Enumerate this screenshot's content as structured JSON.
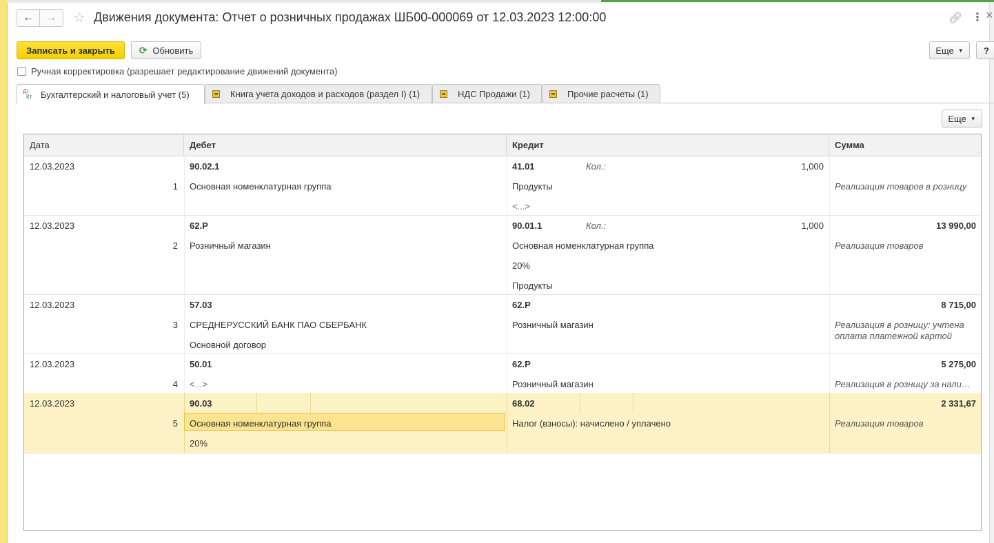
{
  "window": {
    "title": "Движения документа: Отчет о розничных продажах ШБ00-000069 от 12.03.2023 12:00:00"
  },
  "toolbar": {
    "save_close": "Записать и закрыть",
    "refresh": "Обновить",
    "more": "Еще",
    "help": "?"
  },
  "manual_correction": {
    "label": "Ручная корректировка (разрешает редактирование движений документа)",
    "checked": false
  },
  "tabs": [
    {
      "label": "Бухгалтерский и налоговый учет (5)",
      "active": true,
      "icon": "dt-kt-icon"
    },
    {
      "label": "Книга учета доходов и расходов (раздел I) (1)",
      "active": false,
      "icon": "register-icon"
    },
    {
      "label": "НДС Продажи (1)",
      "active": false,
      "icon": "register-icon"
    },
    {
      "label": "Прочие расчеты (1)",
      "active": false,
      "icon": "register-icon"
    }
  ],
  "icons": {
    "dt": "Дт",
    "kt": "Кт"
  },
  "table": {
    "more": "Еще",
    "columns": [
      "Дата",
      "Дебет",
      "Кредит",
      "Сумма"
    ],
    "rows": [
      {
        "date": "12.03.2023",
        "n": "1",
        "debit_account": "90.02.1",
        "debit_lines": [
          "Основная номенклатурная группа"
        ],
        "credit_account": "41.01",
        "qty_label": "Кол.:",
        "qty": "1,000",
        "credit_lines": [
          "Продукты",
          "<...>"
        ],
        "amount": "",
        "description": "Реализация товаров в розницу"
      },
      {
        "date": "12.03.2023",
        "n": "2",
        "debit_account": "62.Р",
        "debit_lines": [
          "Розничный магазин"
        ],
        "credit_account": "90.01.1",
        "qty_label": "Кол.:",
        "qty": "1,000",
        "credit_lines": [
          "Основная номенклатурная группа",
          "20%",
          "Продукты"
        ],
        "amount": "13 990,00",
        "description": "Реализация товаров"
      },
      {
        "date": "12.03.2023",
        "n": "3",
        "debit_account": "57.03",
        "debit_lines": [
          "СРЕДНЕРУССКИЙ БАНК ПАО СБЕРБАНК",
          "Основной договор"
        ],
        "credit_account": "62.Р",
        "credit_lines": [
          "Розничный магазин"
        ],
        "amount": "8 715,00",
        "description": "Реализация в розницу: учтена",
        "description2": "оплата платежной картой"
      },
      {
        "date": "12.03.2023",
        "n": "4",
        "debit_account": "50.01",
        "debit_lines": [
          "<...>"
        ],
        "credit_account": "62.Р",
        "credit_lines": [
          "Розничный магазин"
        ],
        "amount": "5 275,00",
        "description": "Реализация в розницу за нали…"
      },
      {
        "date": "12.03.2023",
        "n": "5",
        "debit_account": "90.03",
        "debit_lines": [
          "Основная номенклатурная группа",
          "20%"
        ],
        "credit_account": "68.02",
        "credit_lines": [
          "Налог (взносы): начислено / уплачено"
        ],
        "amount": "2 331,67",
        "description": "Реализация товаров",
        "selected": true
      }
    ]
  },
  "colors": {
    "accent_yellow": "#f4cf00",
    "selection": "#fdf2c6",
    "focus": "#fbe38f"
  }
}
